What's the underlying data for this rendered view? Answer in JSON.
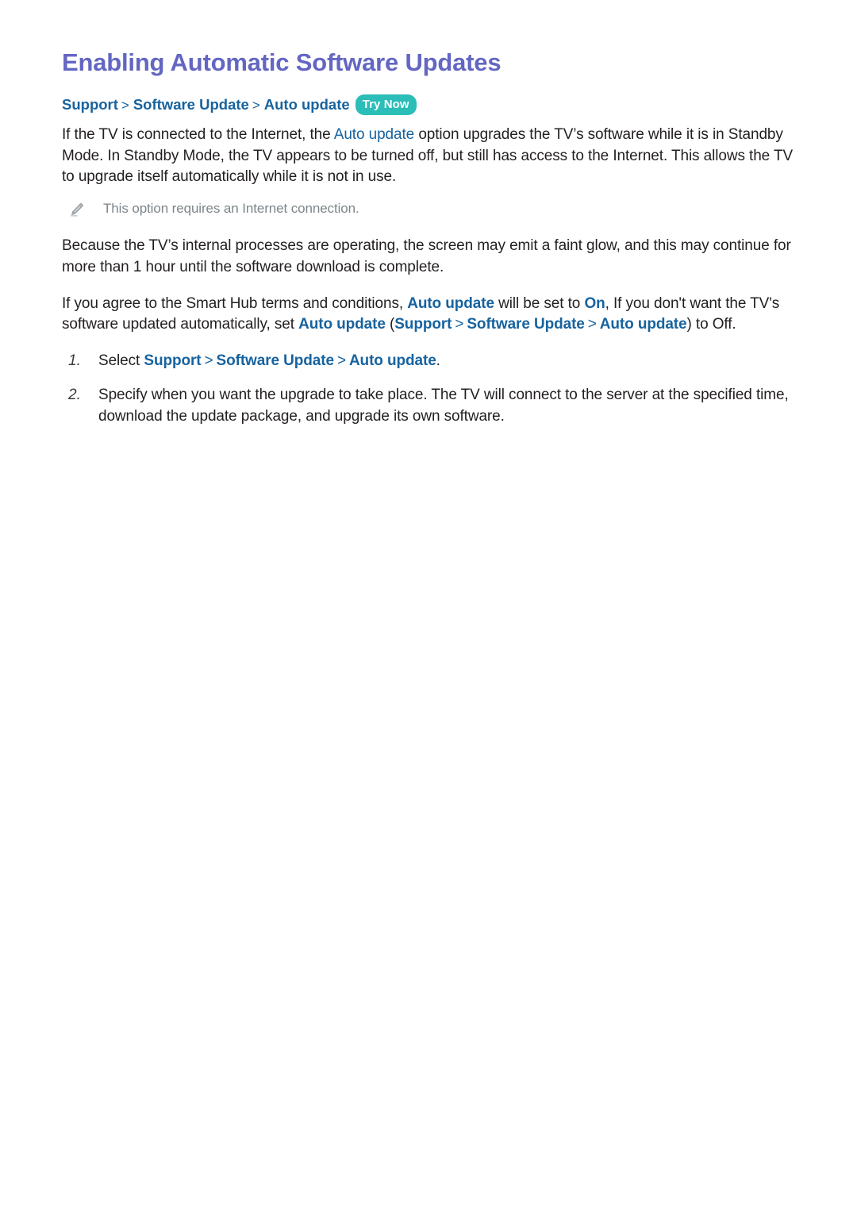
{
  "document": {
    "title": "Enabling Automatic Software Updates",
    "title_color": "#6366c2",
    "link_color": "#17639f",
    "badge_color": "#2bbdb7",
    "note_color": "#7d858a",
    "body_color": "#231f20"
  },
  "breadcrumb": {
    "items": [
      "Support",
      "Software Update",
      "Auto update"
    ],
    "separator": ">",
    "badge_label": "Try Now"
  },
  "paragraphs": {
    "p1": {
      "part1": "If the TV is connected to the Internet, the ",
      "link1": "Auto update",
      "part2": " option upgrades the TV’s software while it is in Standby Mode. In Standby Mode, the TV appears to be turned off, but still has access to the Internet. This allows the TV to upgrade itself automatically while it is not in use."
    },
    "p2": {
      "text": "Because the TV’s internal processes are operating, the screen may emit a faint glow, and this may continue for more than 1 hour until the software download is complete."
    },
    "p3": {
      "part1": "If you agree to the Smart Hub terms and conditions, ",
      "link1": "Auto update",
      "part2": " will be set to ",
      "link2": "On",
      "part3": ", If you don't want the TV's software updated automatically, set ",
      "link3": "Auto update",
      "part4": " (",
      "link4": "Support",
      "sep1": ">",
      "link5": "Software Update",
      "sep2": ">",
      "link6": "Auto update",
      "part5": ") to Off."
    }
  },
  "note": {
    "icon": "pencil-icon",
    "text": "This option requires an Internet connection."
  },
  "steps": [
    {
      "number": "1.",
      "prefix": "Select ",
      "link1": "Support",
      "sep1": ">",
      "link2": "Software Update",
      "sep2": ">",
      "link3": "Auto update",
      "suffix": "."
    },
    {
      "number": "2.",
      "text": "Specify when you want the upgrade to take place. The TV will connect to the server at the specified time, download the update package, and upgrade its own software."
    }
  ]
}
